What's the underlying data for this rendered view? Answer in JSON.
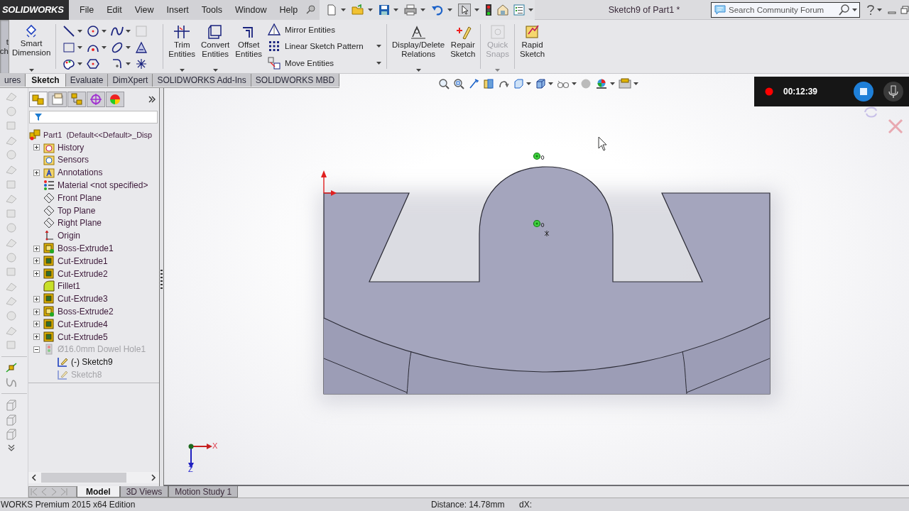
{
  "app": {
    "logo": "SOLIDWORKS",
    "menu": [
      "File",
      "Edit",
      "View",
      "Insert",
      "Tools",
      "Window",
      "Help"
    ],
    "title": "Sketch9 of Part1 *",
    "search": {
      "placeholder": "Search Community Forum"
    }
  },
  "ribbon": {
    "exit_sketch": {
      "label_lines": [
        "t",
        "ch"
      ],
      "selected": true
    },
    "items": [
      {
        "kind": "button",
        "label": "Smart Dimension",
        "dropdown": true,
        "disabled": false
      },
      {
        "kind": "tool-grid"
      },
      {
        "kind": "button",
        "label": "Trim Entities",
        "dropdown": true,
        "disabled": false
      },
      {
        "kind": "button",
        "label": "Convert Entities",
        "dropdown": true,
        "disabled": false
      },
      {
        "kind": "button",
        "label": "Offset Entities",
        "dropdown": false,
        "disabled": false
      },
      {
        "kind": "stack",
        "entries": [
          {
            "label": "Mirror Entities",
            "dropdown": false
          },
          {
            "label": "Linear Sketch Pattern",
            "dropdown": true
          },
          {
            "label": "Move Entities",
            "dropdown": true
          }
        ]
      },
      {
        "kind": "button",
        "label": "Display/Delete Relations",
        "dropdown": true,
        "disabled": false
      },
      {
        "kind": "button",
        "label": "Repair Sketch",
        "dropdown": false,
        "disabled": false
      },
      {
        "kind": "button",
        "label": "Quick Snaps",
        "dropdown": true,
        "disabled": true
      },
      {
        "kind": "button",
        "label": "Rapid Sketch",
        "dropdown": false,
        "disabled": false
      }
    ]
  },
  "command_tabs": [
    {
      "label": "ures",
      "selected": false
    },
    {
      "label": "Sketch",
      "selected": true
    },
    {
      "label": "Evaluate",
      "selected": false
    },
    {
      "label": "DimXpert",
      "selected": false
    },
    {
      "label": "SOLIDWORKS Add-Ins",
      "selected": false
    },
    {
      "label": "SOLIDWORKS MBD",
      "selected": false
    }
  ],
  "panel_tabs": [
    {
      "selected": true
    },
    {
      "selected": false
    },
    {
      "selected": false
    },
    {
      "selected": false
    },
    {
      "selected": false
    }
  ],
  "tree": {
    "label": "Part1  (Default<<Default>_Disp",
    "kind": "part",
    "children": [
      {
        "label": "History",
        "kind": "history",
        "expanded": false,
        "disabled": false
      },
      {
        "label": "Sensors",
        "kind": "sensors",
        "disabled": false
      },
      {
        "label": "Annotations",
        "kind": "annotations",
        "expanded": false,
        "disabled": false
      },
      {
        "label": "Material <not specified>",
        "kind": "material",
        "disabled": false
      },
      {
        "label": "Front Plane",
        "kind": "plane",
        "disabled": false
      },
      {
        "label": "Top Plane",
        "kind": "plane",
        "disabled": false
      },
      {
        "label": "Right Plane",
        "kind": "plane",
        "disabled": false
      },
      {
        "label": "Origin",
        "kind": "origin",
        "disabled": false
      },
      {
        "label": "Boss-Extrude1",
        "kind": "boss",
        "expanded": false,
        "disabled": false
      },
      {
        "label": "Cut-Extrude1",
        "kind": "cut",
        "expanded": false,
        "disabled": false
      },
      {
        "label": "Cut-Extrude2",
        "kind": "cut",
        "expanded": false,
        "disabled": false
      },
      {
        "label": "Fillet1",
        "kind": "fillet",
        "disabled": false
      },
      {
        "label": "Cut-Extrude3",
        "kind": "cut",
        "expanded": false,
        "disabled": false
      },
      {
        "label": "Boss-Extrude2",
        "kind": "boss",
        "expanded": false,
        "disabled": false
      },
      {
        "label": "Cut-Extrude4",
        "kind": "cut",
        "expanded": false,
        "disabled": false
      },
      {
        "label": "Cut-Extrude5",
        "kind": "cut",
        "expanded": false,
        "disabled": false
      },
      {
        "label": "Ø16.0mm Dowel Hole1",
        "kind": "hole",
        "expanded": true,
        "disabled": true,
        "children": [
          {
            "label": "(-) Sketch9",
            "kind": "sketch",
            "disabled": false
          },
          {
            "label": "Sketch8",
            "kind": "sketch",
            "disabled": true
          }
        ]
      }
    ]
  },
  "recording": {
    "time": "00:12:39"
  },
  "triad": {
    "x_label": "X",
    "z_label": "Z"
  },
  "bottom_tabs": [
    {
      "label": "Model",
      "selected": true
    },
    {
      "label": "3D Views",
      "selected": false
    },
    {
      "label": "Motion Study 1",
      "selected": false
    }
  ],
  "status_bar": {
    "edition": "WORKS Premium 2015 x64 Edition",
    "distance": "Distance: 14.78mm",
    "dx": "dX:"
  }
}
